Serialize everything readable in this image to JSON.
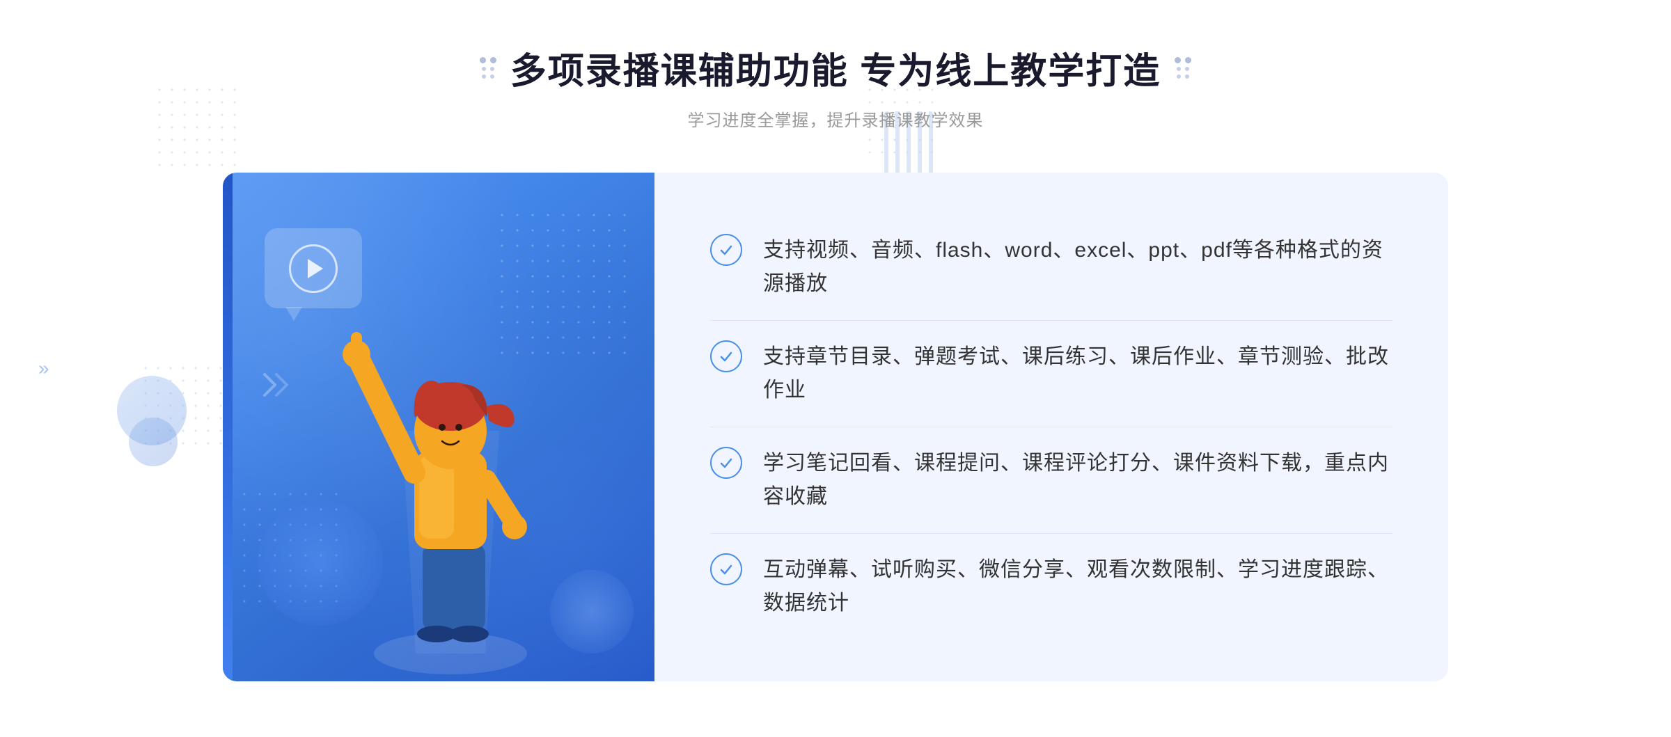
{
  "header": {
    "title": "多项录播课辅助功能 专为线上教学打造",
    "subtitle": "学习进度全掌握，提升录播课教学效果",
    "title_deco_left": "❋",
    "title_deco_right": "❋"
  },
  "features": [
    {
      "id": 1,
      "text": "支持视频、音频、flash、word、excel、ppt、pdf等各种格式的资源播放"
    },
    {
      "id": 2,
      "text": "支持章节目录、弹题考试、课后练习、课后作业、章节测验、批改作业"
    },
    {
      "id": 3,
      "text": "学习笔记回看、课程提问、课程评论打分、课件资料下载，重点内容收藏"
    },
    {
      "id": 4,
      "text": "互动弹幕、试听购买、微信分享、观看次数限制、学习进度跟踪、数据统计"
    }
  ],
  "colors": {
    "primary_blue": "#4285e8",
    "light_blue": "#6aa3f0",
    "text_dark": "#1a1a2e",
    "text_gray": "#999999",
    "text_feature": "#333333",
    "bg_card": "#f0f5ff",
    "check_color": "#4a90e8"
  }
}
